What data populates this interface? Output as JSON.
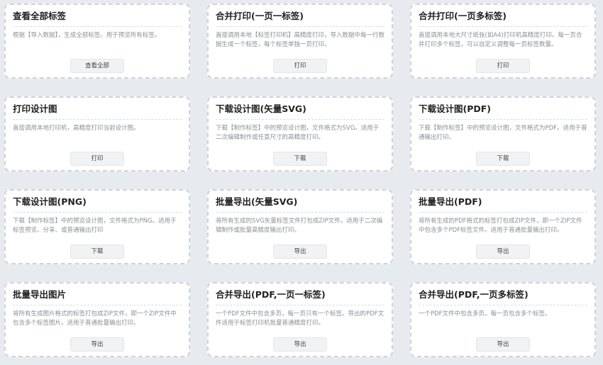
{
  "cards": [
    {
      "title": "查看全部标签",
      "desc": "根据【导入数据】，生成全部标签。用于预览所有标签。",
      "button": "查看全部"
    },
    {
      "title": "合并打印(一页一标签)",
      "desc": "直接调用本地【标签打印机】高精度打印，导入数据中每一行数据生成一个标签，每个标签单独一页打印。",
      "button": "打印"
    },
    {
      "title": "合并打印(一页多标签)",
      "desc": "直接调用本地大尺寸纸张(如A4)打印机高精度打印。每一页合并打印多个标签，可以自定义调整每一页标签数量。",
      "button": "打印"
    },
    {
      "title": "打印设计图",
      "desc": "直接调用本地打印机，高精度打印当前设计图。",
      "button": "打印"
    },
    {
      "title": "下载设计图(矢量SVG)",
      "desc": "下载【制作标签】中的预览设计图，文件格式为SVG。适用于二次编辑制作或任意尺寸的高精度打印。",
      "button": "下载"
    },
    {
      "title": "下载设计图(PDF)",
      "desc": "下载【制作标签】中的预览设计图，文件格式为PDF。适用于普通输出打印。",
      "button": "下载"
    },
    {
      "title": "下载设计图(PNG)",
      "desc": "下载【制作标签】中的预览设计图，文件格式为PNG。适用于标签预览、分享、或普通输出打印",
      "button": "下载"
    },
    {
      "title": "批量导出(矢量SVG)",
      "desc": "将所有生成的SVG矢量标签文件打包成ZIP文件。适用于二次编辑制作或批量高精度输出打印。",
      "button": "导出"
    },
    {
      "title": "批量导出(PDF)",
      "desc": "将所有生成的PDF格式的标签打包成ZIP文件，即一个ZIP文件中包含多个PDF标签文件。适用于普通批量输出打印。",
      "button": "导出"
    },
    {
      "title": "批量导出图片",
      "desc": "将所有生成图片格式的标签打包成ZIP文件，即一个ZIP文件中包含多个标签图片。适用于普通批量输出打印。",
      "button": "导出"
    },
    {
      "title": "合并导出(PDF,一页一标签)",
      "desc": "一个PDF文件中包含多页，每一页只有一个标签。导出的PDF文件适用于标签打印机批量普通精度打印。",
      "button": "导出"
    },
    {
      "title": "合并导出(PDF,一页多标签)",
      "desc": "一个PDF文件中包含多页，每一页包含多个标签。",
      "button": "导出"
    }
  ]
}
